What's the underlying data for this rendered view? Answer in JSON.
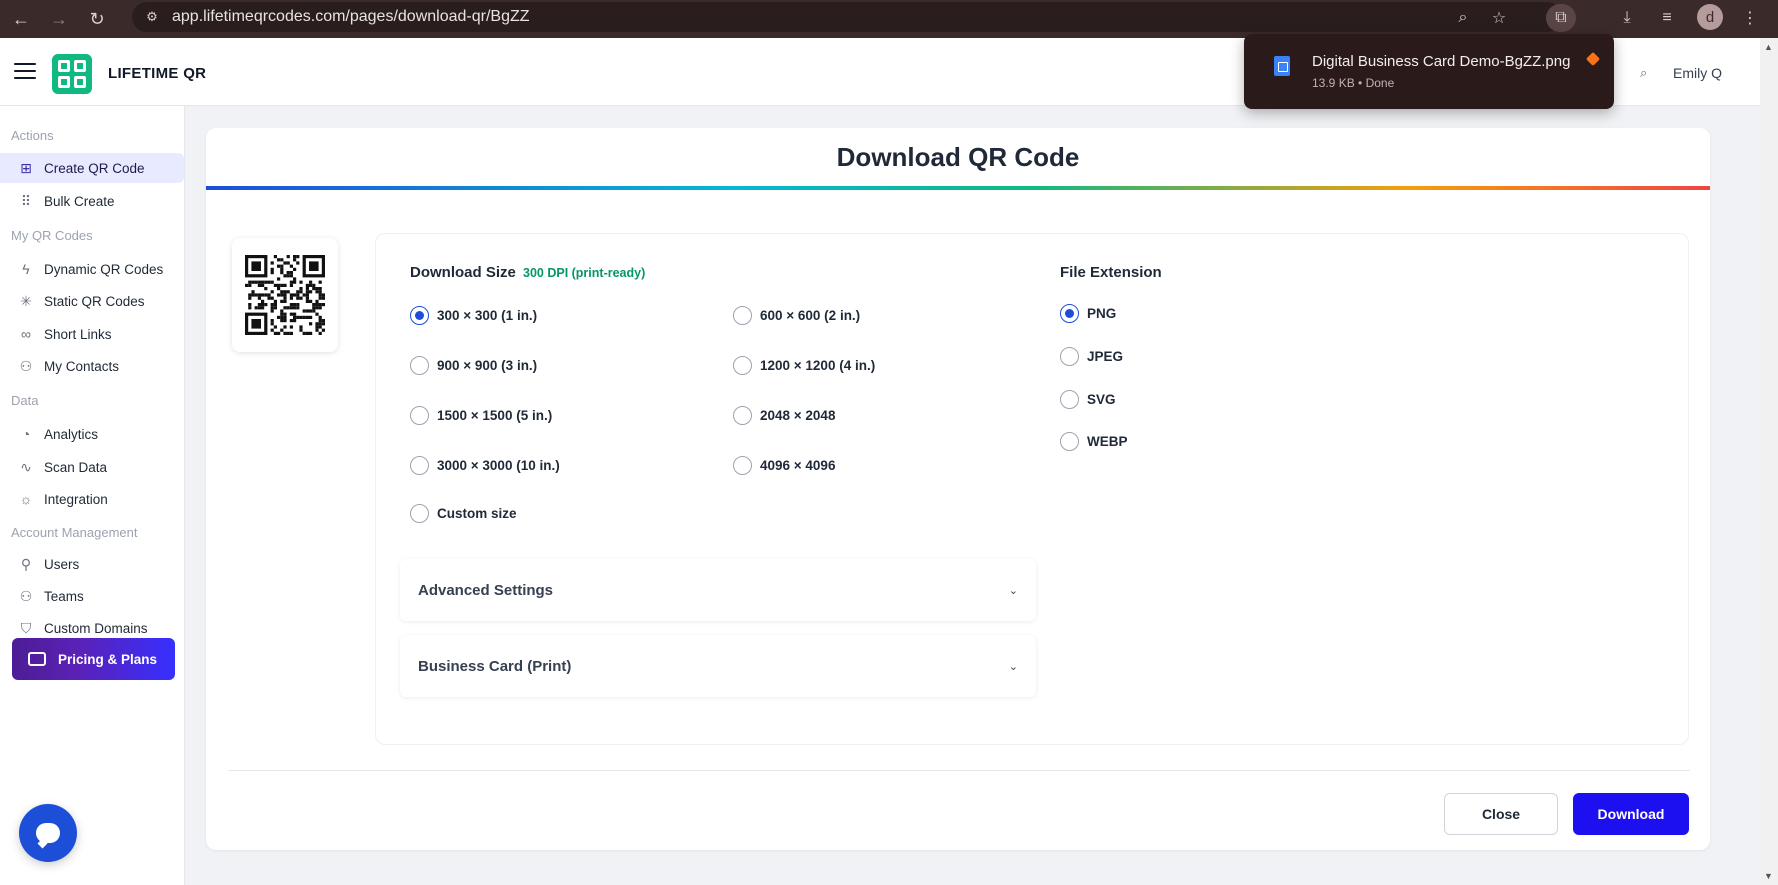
{
  "browser": {
    "url": "app.lifetimeqrcodes.com/pages/download-qr/BgZZ",
    "profile_initial": "d"
  },
  "download_popup": {
    "file_name": "Digital Business Card Demo-BgZZ.png",
    "meta": "13.9 KB • Done"
  },
  "header": {
    "brand": "LIFETIME QR",
    "user_name": "Emily Q"
  },
  "sidebar": {
    "sections": [
      {
        "label": "Actions"
      },
      {
        "label": "My QR Codes"
      },
      {
        "label": "Data"
      },
      {
        "label": "Account Management"
      }
    ],
    "items": [
      {
        "label": "Create QR Code",
        "icon": "plus-square-icon"
      },
      {
        "label": "Bulk Create",
        "icon": "grid-icon"
      },
      {
        "label": "Dynamic QR Codes",
        "icon": "lightning-icon"
      },
      {
        "label": "Static QR Codes",
        "icon": "atom-icon"
      },
      {
        "label": "Short Links",
        "icon": "link-icon"
      },
      {
        "label": "My Contacts",
        "icon": "contacts-icon"
      },
      {
        "label": "Analytics",
        "icon": "pie-chart-icon"
      },
      {
        "label": "Scan Data",
        "icon": "activity-icon"
      },
      {
        "label": "Integration",
        "icon": "integration-icon"
      },
      {
        "label": "Users",
        "icon": "user-icon"
      },
      {
        "label": "Teams",
        "icon": "team-icon"
      },
      {
        "label": "Custom Domains",
        "icon": "shield-icon"
      }
    ],
    "pricing_label": "Pricing & Plans"
  },
  "main": {
    "title": "Download QR Code",
    "download_size_label": "Download Size",
    "dpi_note": "300 DPI (print-ready)",
    "sizes": [
      {
        "label": "300 × 300 (1 in.)",
        "checked": true
      },
      {
        "label": "600 × 600 (2 in.)",
        "checked": false
      },
      {
        "label": "900 × 900 (3 in.)",
        "checked": false
      },
      {
        "label": "1200 × 1200 (4 in.)",
        "checked": false
      },
      {
        "label": "1500 × 1500 (5 in.)",
        "checked": false
      },
      {
        "label": "2048 × 2048",
        "checked": false
      },
      {
        "label": "3000 × 3000 (10 in.)",
        "checked": false
      },
      {
        "label": "4096 × 4096",
        "checked": false
      },
      {
        "label": "Custom size",
        "checked": false
      }
    ],
    "file_extension_label": "File Extension",
    "extensions": [
      {
        "label": "PNG",
        "checked": true
      },
      {
        "label": "JPEG",
        "checked": false
      },
      {
        "label": "SVG",
        "checked": false
      },
      {
        "label": "WEBP",
        "checked": false
      }
    ],
    "accordions": [
      {
        "label": "Advanced Settings"
      },
      {
        "label": "Business Card (Print)"
      }
    ],
    "close_label": "Close",
    "download_label": "Download"
  },
  "colors": {
    "accent": "#1d10f0",
    "brand_green": "#10b981",
    "dpi_green": "#059669",
    "active_nav_bg": "#e8eaff"
  }
}
